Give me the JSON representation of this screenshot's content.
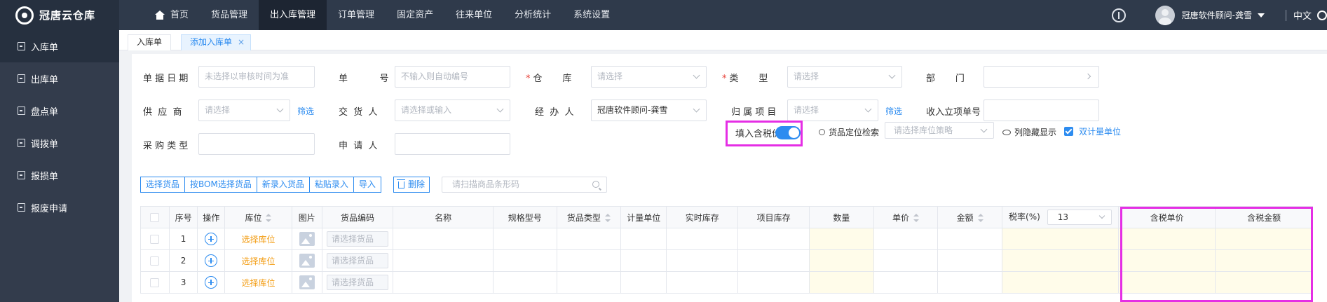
{
  "app": {
    "name": "冠唐云仓库"
  },
  "nav": {
    "items": [
      "首页",
      "货品管理",
      "出入库管理",
      "订单管理",
      "固定资产",
      "往来单位",
      "分析统计",
      "系统设置"
    ],
    "active_index": 2
  },
  "user": {
    "name": "冠唐软件顾问-龚雪",
    "lang": "中文"
  },
  "sidebar": {
    "items": [
      "入库单",
      "出库单",
      "盘点单",
      "调拨单",
      "报损单",
      "报废申请"
    ],
    "active_index": 0
  },
  "tabs": [
    {
      "label": "入库单"
    },
    {
      "label": "添加入库单",
      "close": "×"
    }
  ],
  "form": {
    "bill_date": {
      "label": "单 据 日 期",
      "placeholder": "未选择以审核时间为准"
    },
    "bill_no": {
      "label": "单           号",
      "placeholder": "不输入则自动编号"
    },
    "warehouse": {
      "req": "*",
      "label": "仓       库",
      "placeholder": "请选择"
    },
    "category": {
      "req": "*",
      "label": "类       型",
      "placeholder": "请选择"
    },
    "dept": {
      "label": "部       门"
    },
    "supplier": {
      "label": "供  应  商",
      "placeholder": "请选择",
      "filter": "筛选"
    },
    "deliverer": {
      "label": "交  货  人",
      "placeholder": "请选择或输入"
    },
    "handler": {
      "label": "经  办  人",
      "value": "冠唐软件顾问-龚雪"
    },
    "project": {
      "label": "归 属 项 目",
      "placeholder": "请选择",
      "filter": "筛选"
    },
    "project_no": {
      "label": "收入立项单号"
    },
    "purchase_type": {
      "label": "采 购 类 型"
    },
    "applicant": {
      "label": "申  请  人"
    }
  },
  "toolbar": {
    "buttons": [
      "选择货品",
      "按BOM选择货品",
      "新录入货品",
      "粘贴录入",
      "导入"
    ],
    "delete": "删除",
    "scan_placeholder": "请扫描商品条形码",
    "tax_toggle_label": "填入含税价",
    "tax_toggle_on": true,
    "loc_search": "货品定位检索",
    "loc_placeholder": "请选择库位策略",
    "hide_cols": "列隐藏显示",
    "dual_unit": "双计量单位"
  },
  "table": {
    "headers": [
      "",
      "序号",
      "操作",
      "库位",
      "图片",
      "货品编码",
      "名称",
      "规格型号",
      "货品类型",
      "计量单位",
      "实时库存",
      "项目库存",
      "数量",
      "单价",
      "金额",
      "税率(%)",
      "含税单价",
      "含税金额"
    ],
    "tax_rate": "13",
    "rows": [
      {
        "seq": "1",
        "loc": "选择库位",
        "code": "请选择货品"
      },
      {
        "seq": "2",
        "loc": "选择库位",
        "code": "请选择货品"
      },
      {
        "seq": "3",
        "loc": "选择库位",
        "code": "请选择货品"
      }
    ]
  },
  "colors": {
    "accent": "#2d8cf0",
    "highlight": "#e52ee5",
    "topbar": "#2f3a4b"
  }
}
